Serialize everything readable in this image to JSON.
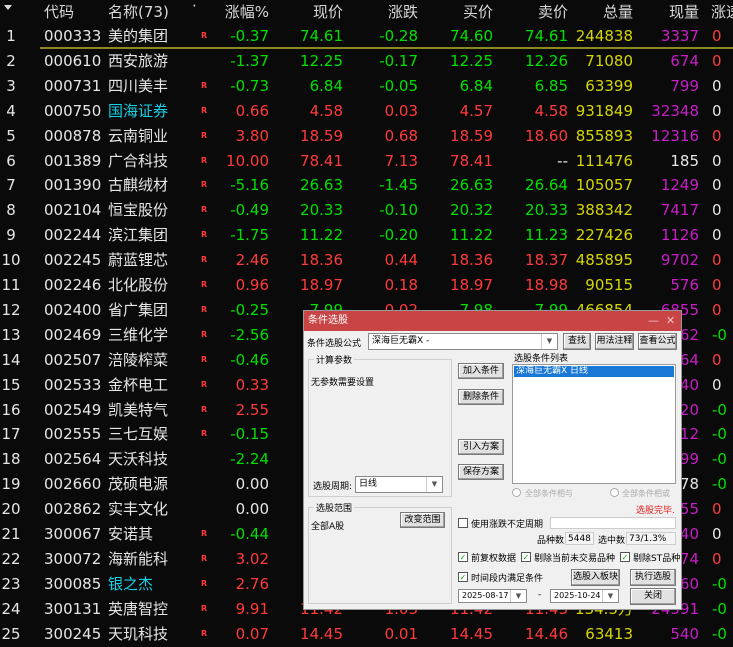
{
  "colors": {
    "up": "#ff3b3b",
    "down": "#00e000",
    "flat": "#e6e6e6",
    "volume": "#d6d600",
    "current": "#c81ec8",
    "cyan_name": "#14d2e6",
    "dialog_title": "#c94545"
  },
  "header": {
    "sort_icon": "triangle-down-icon",
    "code": "代码",
    "name": "名称(73)",
    "dot": "·",
    "pct": "涨幅%",
    "price": "现价",
    "chg": "涨跌",
    "bid": "买价",
    "ask": "卖价",
    "vol": "总量",
    "cur": "现量",
    "speed": "涨速"
  },
  "rows": [
    {
      "n": "1",
      "code": "000333",
      "name": "美的集团",
      "r": "R",
      "pct": "-0.37",
      "price": "74.61",
      "chg": "-0.28",
      "bid": "74.60",
      "ask": "74.61",
      "vol": "244838",
      "cur": "3337",
      "speed": "0",
      "sc": "up"
    },
    {
      "n": "2",
      "code": "000610",
      "name": "西安旅游",
      "r": "",
      "pct": "-1.37",
      "price": "12.25",
      "chg": "-0.17",
      "bid": "12.25",
      "ask": "12.26",
      "vol": "71080",
      "cur": "674",
      "speed": "0",
      "sc": "up"
    },
    {
      "n": "3",
      "code": "000731",
      "name": "四川美丰",
      "r": "R",
      "pct": "-0.73",
      "price": "6.84",
      "chg": "-0.05",
      "bid": "6.84",
      "ask": "6.85",
      "vol": "63399",
      "cur": "799",
      "speed": "0",
      "sc": "flat"
    },
    {
      "n": "4",
      "code": "000750",
      "name": "国海证券",
      "cyan": true,
      "r": "R",
      "pct": "0.66",
      "price": "4.58",
      "chg": "0.03",
      "bid": "4.57",
      "ask": "4.58",
      "vol": "931849",
      "cur": "32348",
      "speed": "0",
      "sc": "flat"
    },
    {
      "n": "5",
      "code": "000878",
      "name": "云南铜业",
      "r": "R",
      "pct": "3.80",
      "price": "18.59",
      "chg": "0.68",
      "bid": "18.59",
      "ask": "18.60",
      "vol": "855893",
      "cur": "12316",
      "speed": "0",
      "sc": "up"
    },
    {
      "n": "6",
      "code": "001389",
      "name": "广合科技",
      "r": "R",
      "pct": "10.00",
      "price": "78.41",
      "chg": "7.13",
      "bid": "78.41",
      "ask": "--",
      "vol": "111476",
      "cur": "185",
      "cw": true,
      "speed": "0",
      "sc": "flat"
    },
    {
      "n": "7",
      "code": "001390",
      "name": "古麒绒材",
      "r": "R",
      "pct": "-5.16",
      "price": "26.63",
      "chg": "-1.45",
      "bid": "26.63",
      "ask": "26.64",
      "vol": "105057",
      "cur": "1249",
      "speed": "0",
      "sc": "flat"
    },
    {
      "n": "8",
      "code": "002104",
      "name": "恒宝股份",
      "r": "R",
      "pct": "-0.49",
      "price": "20.33",
      "chg": "-0.10",
      "bid": "20.32",
      "ask": "20.33",
      "vol": "388342",
      "cur": "7417",
      "speed": "0",
      "sc": "flat"
    },
    {
      "n": "9",
      "code": "002244",
      "name": "滨江集团",
      "r": "R",
      "pct": "-1.75",
      "price": "11.22",
      "chg": "-0.20",
      "bid": "11.22",
      "ask": "11.23",
      "vol": "227426",
      "cur": "1126",
      "speed": "0",
      "sc": "flat"
    },
    {
      "n": "10",
      "code": "002245",
      "name": "蔚蓝锂芯",
      "r": "R",
      "pct": "2.46",
      "price": "18.36",
      "chg": "0.44",
      "bid": "18.36",
      "ask": "18.37",
      "vol": "485895",
      "cur": "9702",
      "speed": "0",
      "sc": "up"
    },
    {
      "n": "11",
      "code": "002246",
      "name": "北化股份",
      "r": "R",
      "pct": "0.96",
      "price": "18.97",
      "chg": "0.18",
      "bid": "18.97",
      "ask": "18.98",
      "vol": "90515",
      "cur": "576",
      "speed": "0",
      "sc": "up"
    },
    {
      "n": "12",
      "code": "002400",
      "name": "省广集团",
      "r": "R",
      "pct": "-0.25",
      "price": "7.99",
      "chg": "0.02",
      "bid": "7.98",
      "ask": "7.99",
      "vol": "466854",
      "cur": "6855",
      "speed": "0",
      "sc": "up"
    },
    {
      "n": "13",
      "code": "002469",
      "name": "三维化学",
      "r": "R",
      "pct": "-2.56",
      "cur": "62",
      "speed": "-0",
      "sc": "down"
    },
    {
      "n": "14",
      "code": "002507",
      "name": "涪陵榨菜",
      "r": "R",
      "pct": "-0.46",
      "cur": "64",
      "speed": "0",
      "sc": "up"
    },
    {
      "n": "15",
      "code": "002533",
      "name": "金杯电工",
      "r": "R",
      "pct": "0.33",
      "cur": "40",
      "speed": "0",
      "sc": "flat"
    },
    {
      "n": "16",
      "code": "002549",
      "name": "凯美特气",
      "r": "R",
      "pct": "2.55",
      "cur": "20",
      "speed": "-0",
      "sc": "down"
    },
    {
      "n": "17",
      "code": "002555",
      "name": "三七互娱",
      "r": "R",
      "pct": "-0.15",
      "cur": "12",
      "speed": "-0",
      "sc": "down"
    },
    {
      "n": "18",
      "code": "002564",
      "name": "天沃科技",
      "r": "",
      "pct": "-2.24",
      "cur": "99",
      "speed": "-0",
      "sc": "down"
    },
    {
      "n": "19",
      "code": "002660",
      "name": "茂硕电源",
      "r": "",
      "pct": "0.00",
      "cur": "78",
      "cw": true,
      "speed": "-0",
      "sc": "down"
    },
    {
      "n": "20",
      "code": "002862",
      "name": "实丰文化",
      "r": "",
      "pct": "0.00",
      "cur": "55",
      "speed": "0",
      "sc": "up"
    },
    {
      "n": "21",
      "code": "300067",
      "name": "安诺其",
      "r": "R",
      "pct": "-0.44",
      "cur": "40",
      "speed": "0",
      "sc": "flat"
    },
    {
      "n": "22",
      "code": "300072",
      "name": "海新能科",
      "r": "R",
      "pct": "3.02",
      "cur": "74",
      "speed": "0",
      "sc": "up"
    },
    {
      "n": "23",
      "code": "300085",
      "name": "银之杰",
      "cyan": true,
      "r": "R",
      "pct": "2.76",
      "cur": "60",
      "speed": "-0",
      "sc": "down"
    },
    {
      "n": "24",
      "code": "300131",
      "name": "英唐智控",
      "r": "R",
      "pct": "9.91",
      "price": "11.42",
      "chg": "1.03",
      "bid": "11.42",
      "ask": "11.43",
      "vol": "134.5万",
      "cur": "24591",
      "speed": "-0",
      "sc": "down"
    },
    {
      "n": "25",
      "code": "300245",
      "name": "天玑科技",
      "r": "R",
      "pct": "0.07",
      "price": "14.45",
      "chg": "0.01",
      "bid": "14.45",
      "ask": "14.46",
      "vol": "63413",
      "cur": "540",
      "speed": "-0",
      "sc": "down"
    }
  ],
  "dialog": {
    "title": "条件选股",
    "minimize": "—",
    "close": "✕",
    "formula_label": "条件选股公式",
    "formula_value": "深海巨无霸X  -",
    "find": "查找",
    "usage": "用法注释",
    "view_formula": "查看公式",
    "params_group": "计算参数",
    "params_text": "无参数需要设置",
    "period_label": "选股周期:",
    "period_value": "日线",
    "add_cond": "加入条件",
    "del_cond": "删除条件",
    "import_plan": "引入方案",
    "save_plan": "保存方案",
    "list_label": "选股条件列表",
    "list_items": [
      "深海巨无霸X  日线"
    ],
    "radio_and": "全部条件相与",
    "radio_or": "全部条件相或",
    "status": "选股完毕.",
    "scope_group": "选股范围",
    "scope_value": "全部A股",
    "change_scope": "改变范围",
    "use_period": "使用涨跌不定周期",
    "count_label": "品种数",
    "count_value": "5448",
    "selected_label": "选中数",
    "selected_value": "73/1.3%",
    "chk_prev": "前复权数据",
    "chk_untraded": "剔除当前未交易品种",
    "chk_st": "剔除ST品种",
    "chk_timerange": "时间段内满足条件",
    "to_block": "选股入板块",
    "execute": "执行选股",
    "date_from": "2025-08-17",
    "date_sep": "-",
    "date_to": "2025-10-24",
    "close_btn": "关闭"
  }
}
